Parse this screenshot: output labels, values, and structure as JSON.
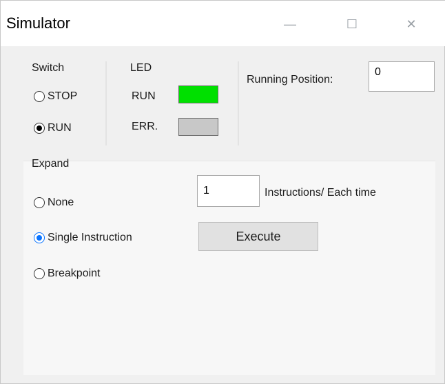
{
  "window": {
    "title": "Simulator",
    "controls": {
      "minimize": "—",
      "maximize": "☐",
      "close": "✕"
    }
  },
  "switch": {
    "label": "Switch",
    "options": [
      {
        "label": "STOP",
        "selected": false
      },
      {
        "label": "RUN",
        "selected": true
      }
    ]
  },
  "led": {
    "label": "LED",
    "items": [
      {
        "label": "RUN",
        "color": "#00e000"
      },
      {
        "label": "ERR.",
        "color": "#c8c8c8"
      }
    ]
  },
  "running_position": {
    "label": "Running Position:",
    "value": "0"
  },
  "expand": {
    "label": "Expand",
    "options": [
      {
        "label": "None",
        "selected": false
      },
      {
        "label": "Single Instruction",
        "selected": true
      },
      {
        "label": "Breakpoint",
        "selected": false
      }
    ],
    "instructions_value": "1",
    "instructions_label": "Instructions/ Each time",
    "execute_label": "Execute"
  }
}
